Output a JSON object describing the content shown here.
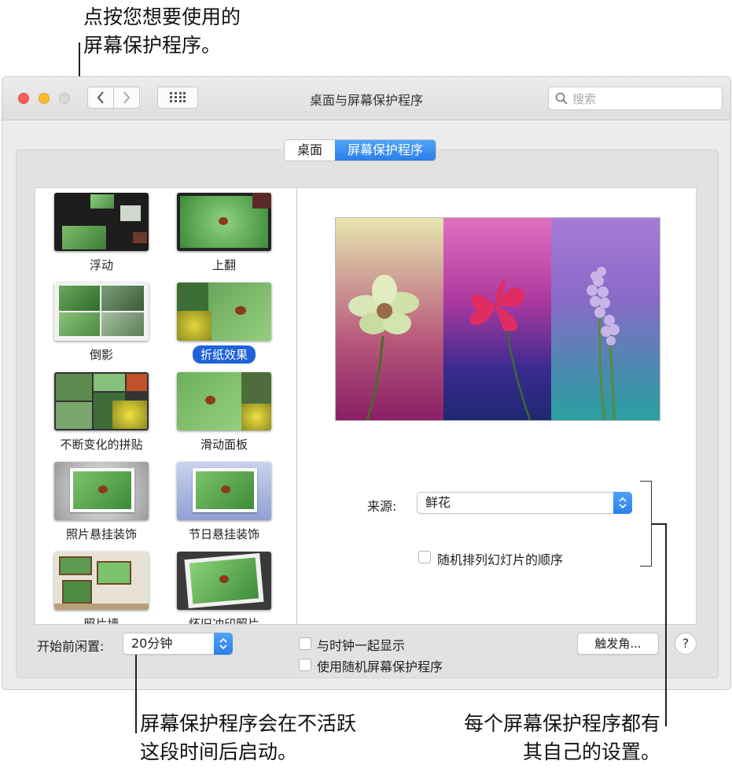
{
  "callouts": {
    "top": [
      "点按您想要使用的",
      "屏幕保护程序。"
    ],
    "bottom_left": [
      "屏幕保护程序会在不活跃",
      "这段时间后启动。"
    ],
    "bottom_right": [
      "每个屏幕保护程序都有",
      "其自己的设置。"
    ]
  },
  "window": {
    "title": "桌面与屏幕保护程序",
    "search_placeholder": "搜索"
  },
  "tabs": [
    {
      "label": "桌面",
      "active": false
    },
    {
      "label": "屏幕保护程序",
      "active": true
    }
  ],
  "screensavers": [
    {
      "label": "浮动",
      "selected": false
    },
    {
      "label": "上翻",
      "selected": false
    },
    {
      "label": "倒影",
      "selected": false
    },
    {
      "label": "折纸效果",
      "selected": true
    },
    {
      "label": "不断变化的拼贴",
      "selected": false
    },
    {
      "label": "滑动面板",
      "selected": false
    },
    {
      "label": "照片悬挂装饰",
      "selected": false
    },
    {
      "label": "节日悬挂装饰",
      "selected": false
    },
    {
      "label": "照片墙",
      "selected": false
    },
    {
      "label": "怀旧冲印照片",
      "selected": false
    }
  ],
  "options": {
    "source_label": "来源:",
    "source_value": "鲜花",
    "shuffle_label": "随机排列幻灯片的顺序"
  },
  "bottom": {
    "idle_label": "开始前闲置:",
    "idle_value": "20分钟",
    "show_clock_label": "与时钟一起显示",
    "random_saver_label": "使用随机屏幕保护程序",
    "hot_corners_label": "触发角...",
    "help_label": "?"
  },
  "colors": {
    "accent": "#2b7fe9",
    "selection": "#1f62d8"
  }
}
